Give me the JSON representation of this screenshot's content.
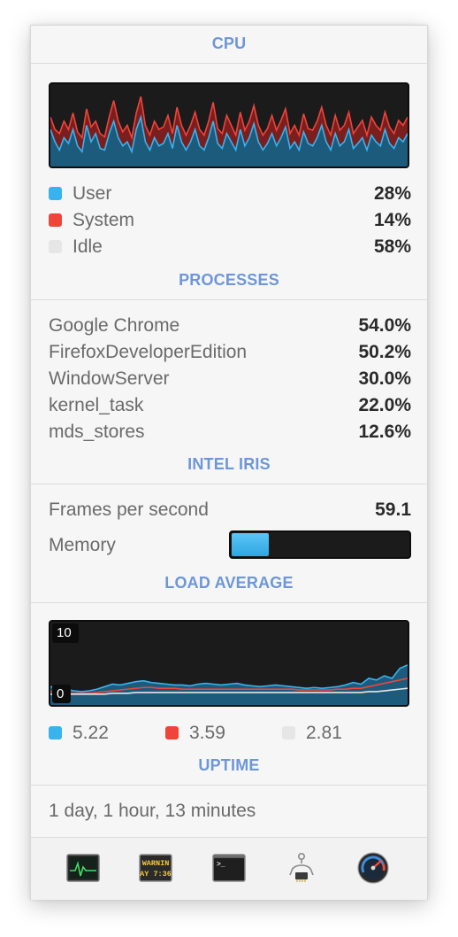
{
  "cpu": {
    "header": "CPU",
    "legend": [
      {
        "label": "User",
        "value": "28%",
        "color": "#37b3f0"
      },
      {
        "label": "System",
        "value": "14%",
        "color": "#f0443a"
      },
      {
        "label": "Idle",
        "value": "58%",
        "color": "#e2e2e2"
      }
    ],
    "graph": {
      "user": [
        0.45,
        0.3,
        0.2,
        0.35,
        0.28,
        0.45,
        0.25,
        0.18,
        0.5,
        0.3,
        0.4,
        0.22,
        0.2,
        0.4,
        0.55,
        0.35,
        0.25,
        0.3,
        0.18,
        0.45,
        0.6,
        0.3,
        0.2,
        0.35,
        0.25,
        0.28,
        0.4,
        0.22,
        0.5,
        0.3,
        0.2,
        0.3,
        0.45,
        0.25,
        0.2,
        0.35,
        0.55,
        0.28,
        0.22,
        0.4,
        0.3,
        0.2,
        0.45,
        0.25,
        0.35,
        0.52,
        0.3,
        0.2,
        0.28,
        0.4,
        0.25,
        0.35,
        0.48,
        0.22,
        0.3,
        0.2,
        0.42,
        0.28,
        0.25,
        0.35,
        0.5,
        0.3,
        0.2,
        0.4,
        0.25,
        0.3,
        0.45,
        0.22,
        0.28,
        0.35,
        0.2,
        0.38,
        0.3,
        0.25,
        0.45,
        0.28,
        0.22,
        0.35,
        0.3,
        0.4
      ],
      "system": [
        0.6,
        0.45,
        0.4,
        0.55,
        0.45,
        0.65,
        0.42,
        0.35,
        0.7,
        0.48,
        0.55,
        0.4,
        0.36,
        0.6,
        0.8,
        0.55,
        0.42,
        0.5,
        0.35,
        0.65,
        0.85,
        0.5,
        0.38,
        0.55,
        0.45,
        0.48,
        0.62,
        0.4,
        0.72,
        0.5,
        0.38,
        0.5,
        0.66,
        0.45,
        0.38,
        0.55,
        0.78,
        0.46,
        0.4,
        0.62,
        0.5,
        0.38,
        0.66,
        0.44,
        0.55,
        0.74,
        0.5,
        0.38,
        0.46,
        0.62,
        0.44,
        0.56,
        0.7,
        0.4,
        0.5,
        0.38,
        0.64,
        0.46,
        0.44,
        0.55,
        0.72,
        0.5,
        0.38,
        0.62,
        0.44,
        0.5,
        0.66,
        0.4,
        0.48,
        0.56,
        0.38,
        0.6,
        0.5,
        0.44,
        0.66,
        0.48,
        0.4,
        0.56,
        0.5,
        0.6
      ]
    }
  },
  "processes": {
    "header": "PROCESSES",
    "items": [
      {
        "name": "Google Chrome",
        "value": "54.0%"
      },
      {
        "name": "FirefoxDeveloperEdition",
        "value": "50.2%"
      },
      {
        "name": "WindowServer",
        "value": "30.0%"
      },
      {
        "name": "kernel_task",
        "value": "22.0%"
      },
      {
        "name": "mds_stores",
        "value": "12.6%"
      }
    ]
  },
  "gpu": {
    "header": "INTEL IRIS",
    "fps_label": "Frames per second",
    "fps_value": "59.1",
    "memory_label": "Memory",
    "memory_fraction": 0.21
  },
  "load": {
    "header": "LOAD AVERAGE",
    "scale_max_label": "10",
    "scale_min_label": "0",
    "legend": [
      {
        "value": "5.22",
        "color": "#37b3f0"
      },
      {
        "value": "3.59",
        "color": "#f0443a"
      },
      {
        "value": "2.81",
        "color": "#e2e2e2"
      }
    ],
    "graph": {
      "one": [
        2.2,
        2.0,
        1.9,
        1.7,
        1.6,
        1.7,
        1.9,
        2.2,
        2.5,
        2.4,
        2.6,
        2.8,
        2.9,
        2.7,
        2.6,
        2.5,
        2.4,
        2.4,
        2.3,
        2.5,
        2.6,
        2.5,
        2.4,
        2.5,
        2.6,
        2.4,
        2.3,
        2.2,
        2.3,
        2.4,
        2.3,
        2.2,
        2.1,
        2.0,
        2.1,
        2.0,
        2.1,
        2.2,
        2.4,
        2.7,
        2.5,
        3.2,
        3.0,
        3.5,
        3.2,
        4.4,
        4.8
      ],
      "five": [
        1.6,
        1.5,
        1.5,
        1.4,
        1.4,
        1.4,
        1.5,
        1.6,
        1.7,
        1.8,
        1.9,
        2.0,
        2.1,
        2.1,
        2.0,
        2.0,
        2.0,
        1.9,
        1.9,
        1.9,
        1.9,
        1.9,
        1.9,
        1.9,
        1.9,
        1.9,
        1.9,
        1.9,
        1.9,
        1.9,
        1.9,
        1.9,
        1.8,
        1.8,
        1.8,
        1.8,
        1.8,
        1.9,
        1.9,
        2.0,
        2.0,
        2.2,
        2.4,
        2.6,
        2.8,
        3.0,
        3.2
      ],
      "fifteen": [
        1.3,
        1.3,
        1.3,
        1.3,
        1.3,
        1.3,
        1.3,
        1.3,
        1.4,
        1.4,
        1.4,
        1.5,
        1.5,
        1.5,
        1.5,
        1.5,
        1.5,
        1.5,
        1.5,
        1.5,
        1.5,
        1.5,
        1.5,
        1.5,
        1.5,
        1.5,
        1.5,
        1.5,
        1.5,
        1.5,
        1.5,
        1.5,
        1.5,
        1.5,
        1.5,
        1.5,
        1.5,
        1.5,
        1.5,
        1.5,
        1.5,
        1.6,
        1.6,
        1.7,
        1.8,
        1.9,
        2.0
      ],
      "max": 10
    }
  },
  "uptime": {
    "header": "UPTIME",
    "text": "1 day, 1 hour, 13 minutes"
  },
  "toolbar": {
    "console_text_1": "WARNIN",
    "console_text_2": "AY 7:36",
    "terminal_prompt": ">_",
    "icons": [
      "activity-monitor-icon",
      "console-icon",
      "terminal-icon",
      "system-information-icon",
      "istat-menus-icon"
    ]
  },
  "colors": {
    "accent": "#6d97d9",
    "user": "#37b3f0",
    "system": "#f0443a",
    "idle": "#e2e2e2"
  }
}
